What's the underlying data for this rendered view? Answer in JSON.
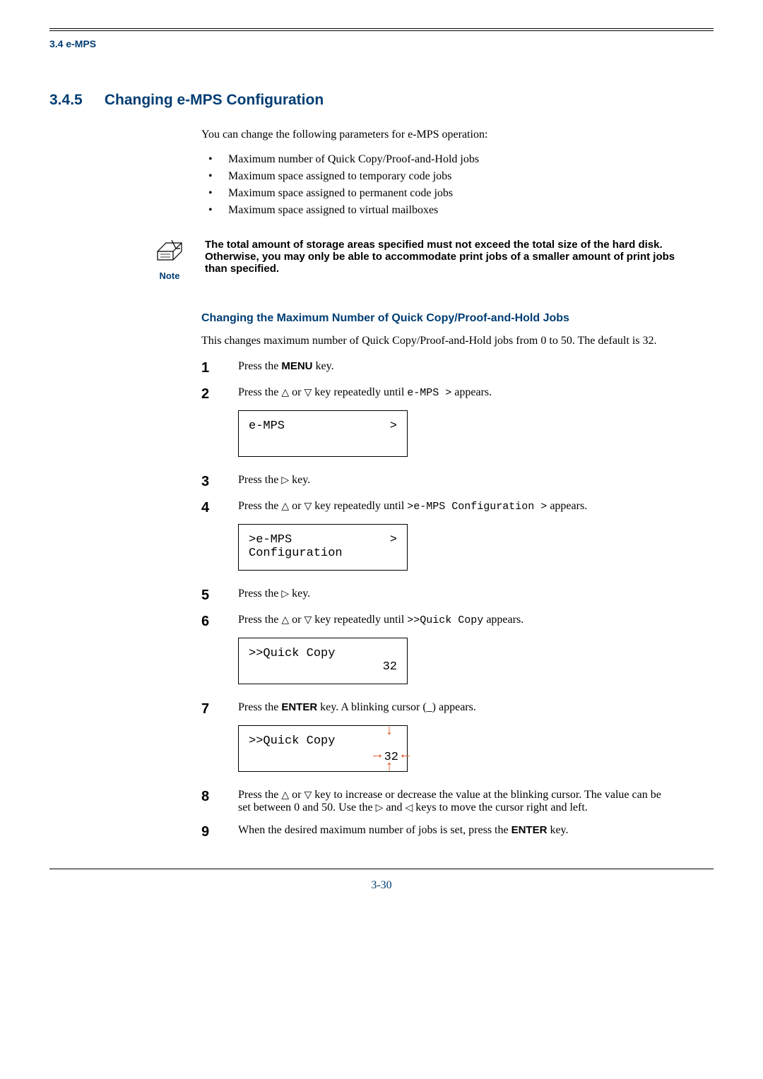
{
  "header": {
    "section_ref": "3.4 e-MPS"
  },
  "heading": {
    "number": "3.4.5",
    "title": "Changing e-MPS Configuration"
  },
  "intro": "You can change the following parameters for e-MPS operation:",
  "bullets": [
    "Maximum number of Quick Copy/Proof-and-Hold jobs",
    "Maximum space assigned to temporary code jobs",
    "Maximum space assigned to permanent code jobs",
    "Maximum space assigned to virtual mailboxes"
  ],
  "note": {
    "caption": "Note",
    "text": "The total amount of storage areas specified must not exceed the total size of the hard disk. Otherwise, you may only be able to accommodate print jobs of a smaller amount of print jobs than specified."
  },
  "subheading": "Changing the Maximum Number of Quick Copy/Proof-and-Hold Jobs",
  "subtext": "This changes maximum number of Quick Copy/Proof-and-Hold jobs from 0 to 50. The default is 32.",
  "steps": [
    {
      "n": "1",
      "pre": "Press the ",
      "bold": "MENU",
      "post": " key."
    },
    {
      "n": "2",
      "pre": "Press the ",
      "glyph1": "△",
      "mid": " or ",
      "glyph2": "▽",
      "post1": " key repeatedly until ",
      "mono": "e-MPS >",
      "post2": " appears.",
      "display": {
        "l1_left": "e-MPS",
        "l1_right": ">",
        "l2": ""
      }
    },
    {
      "n": "3",
      "pre": "Press the ",
      "glyph1": "▷",
      "post": " key."
    },
    {
      "n": "4",
      "pre": "Press the ",
      "glyph1": "△",
      "mid": " or ",
      "glyph2": "▽",
      "post1": " key repeatedly until ",
      "mono": ">e-MPS Configuration >",
      "post2": " appears.",
      "display": {
        "l1_left": ">e-MPS",
        "l1_right": ">",
        "l2": " Configuration"
      }
    },
    {
      "n": "5",
      "pre": "Press the ",
      "glyph1": "▷",
      "post": " key."
    },
    {
      "n": "6",
      "pre": "Press the ",
      "glyph1": "△",
      "mid": " or ",
      "glyph2": "▽",
      "post1": " key repeatedly until ",
      "mono": ">>Quick Copy",
      "post2": " appears.",
      "display": {
        "l1_left": ">>Quick Copy",
        "l2_right": "32"
      }
    },
    {
      "n": "7",
      "pre": "Press the ",
      "bold": "ENTER",
      "post": " key. A blinking cursor (_) appears.",
      "display_blink": {
        "l1_left": ">>Quick Copy",
        "value": "32"
      }
    },
    {
      "n": "8",
      "pre": "Press the ",
      "glyph1": "△",
      "mid": " or ",
      "glyph2": "▽",
      "post1": " key to increase or decrease the value at the blinking cursor. The value can be set between 0 and 50. Use the ",
      "glyph3": "▷",
      "mid2": " and ",
      "glyph4": "◁",
      "post2": " keys to move the cursor right and left."
    },
    {
      "n": "9",
      "pre": "When the desired maximum number of jobs is set, press the ",
      "bold": "ENTER",
      "post": " key."
    }
  ],
  "footer": {
    "page": "3-30"
  }
}
